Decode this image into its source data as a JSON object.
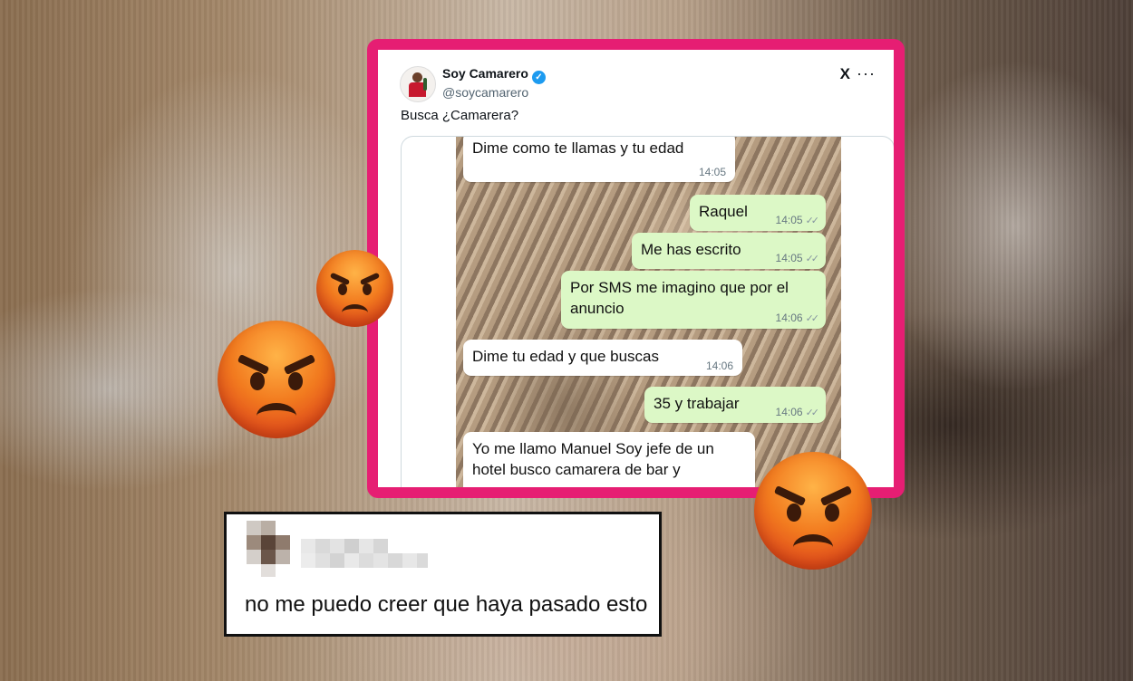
{
  "tweet": {
    "author_name": "Soy Camarero",
    "handle": "@soycamarero",
    "platform_logo": "X",
    "more_icon": "more-icon",
    "text": "Busca ¿Camarera?",
    "frame_color": "#e61e73",
    "verified_color": "#1d9bf0"
  },
  "chat": {
    "messages": [
      {
        "direction": "in",
        "text": "Dime como te llamas y tu edad",
        "time": "14:05"
      },
      {
        "direction": "out",
        "text": "Raquel",
        "time": "14:05"
      },
      {
        "direction": "out",
        "text": "Me has escrito",
        "time": "14:05"
      },
      {
        "direction": "out",
        "text": "Por SMS me imagino que por el anuncio",
        "time": "14:06"
      },
      {
        "direction": "in",
        "text": "Dime tu edad y que buscas",
        "time": "14:06"
      },
      {
        "direction": "out",
        "text": "35 y trabajar",
        "time": "14:06"
      },
      {
        "direction": "in",
        "text": "Yo me llamo Manuel Soy jefe de un hotel busco camarera de bar y",
        "time": ""
      }
    ],
    "bubble_in_color": "#ffffff",
    "bubble_out_color": "#dcf8c6",
    "read_ticks": "✓✓"
  },
  "comment": {
    "text": "no me puedo creer que haya pasado esto",
    "username_pixelated": true
  },
  "emojis": [
    "angry-face-icon",
    "angry-face-icon",
    "angry-face-icon"
  ]
}
